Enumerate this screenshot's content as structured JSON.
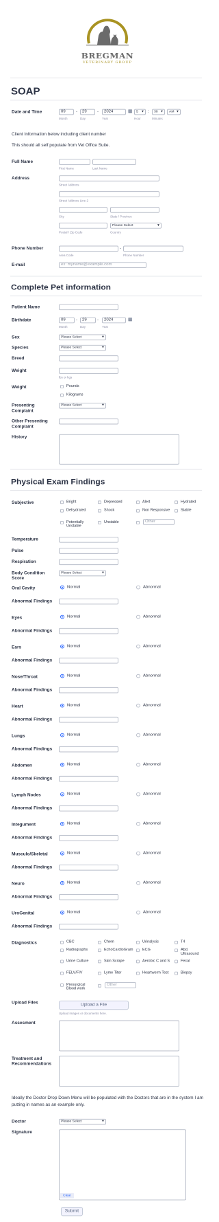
{
  "brand": {
    "name": "BREGMAN",
    "subtitle": "VETERINARY GROUP"
  },
  "form_title": "SOAP",
  "date_time": {
    "label": "Date and Time",
    "month": "09",
    "day": "29",
    "year": "2024",
    "hour": "5",
    "minute": "30",
    "ampm": "AM",
    "month_sub": "Month",
    "day_sub": "Day",
    "year_sub": "Year",
    "hour_sub": "Hour",
    "minute_sub": "Minutes"
  },
  "client_info_note": "Client Information below including client number",
  "autopopulate_note": "This should all self populate from Vet Office Suite.",
  "full_name": {
    "label": "Full Name",
    "first_sub": "First Name",
    "last_sub": "Last Name"
  },
  "address": {
    "label": "Address",
    "line1_sub": "Street Address",
    "line2_sub": "Street Address Line 2",
    "city_sub": "City",
    "state_sub": "State / Province",
    "postal_sub": "Postal / Zip Code",
    "country_sub": "Country",
    "country_value": "Please Select"
  },
  "phone": {
    "label": "Phone Number",
    "area_sub": "Area Code",
    "number_sub": "Phone Number"
  },
  "email": {
    "label": "E-mail",
    "placeholder": "ex: myname@example.com"
  },
  "pet_section_title": "Complete Pet information",
  "pet": {
    "name_label": "Patient Name",
    "birthdate_label": "Birthdate",
    "birth_month": "09",
    "birth_day": "29",
    "birth_year": "2024",
    "month_sub": "Month",
    "day_sub": "Day",
    "year_sub": "Year",
    "sex_label": "Sex",
    "sex_value": "Please Select",
    "species_label": "Species",
    "species_value": "Please Select",
    "breed_label": "Breed",
    "weight_label": "Weight",
    "weight_sub": "lbs or kgs",
    "weight_unit_label": "Weight",
    "unit_pounds": "Pounds",
    "unit_kilograms": "Kilograms",
    "complaint_label": "Presenting Complaint",
    "complaint_value": "Please Select",
    "other_complaint_label": "Other Presenting Complaint",
    "history_label": "History"
  },
  "exam_section_title": "Physical Exam Findings",
  "subjective": {
    "label": "Subjective",
    "options": [
      "Bright",
      "Depressed",
      "Alert",
      "Hydrated",
      "Dehydrated",
      "Shock",
      "Non Responsive",
      "Stable",
      "Potentially Unstable",
      "Unstable",
      "Other"
    ]
  },
  "vitals": {
    "temperature": "Temperature",
    "pulse": "Pulse",
    "respiration": "Respiration",
    "bcs_label": "Body Condition Score",
    "bcs_value": "Please Select"
  },
  "systems": [
    "Oral Cavity",
    "Eyes",
    "Ears",
    "Nose/Throat",
    "Heart",
    "Lungs",
    "Abdomen",
    "Lymph Nodes",
    "Integument",
    "Musculo/Skeletal",
    "Neuro",
    "UroGenital"
  ],
  "radio_normal": "Normal",
  "radio_abnormal": "Abnormal",
  "abnormal_findings_label": "Abnormal Findings",
  "diagnostics": {
    "label": "Diagnostics",
    "options": [
      "CBC",
      "Chem",
      "Urinalysis",
      "T4",
      "Radiographs",
      "EchoCardioGram",
      "ECG",
      "Abd. Ultrasound",
      "Urine Culture",
      "Skin Scrape",
      "Aerobic C and S",
      "Fecal",
      "FELV/FIV",
      "Lyme Titer",
      "Heartworm Test",
      "Biopsy",
      "Presurgical Blood work",
      "Other"
    ]
  },
  "upload": {
    "label": "Upload Files",
    "button": "Upload a File",
    "sub": "Upload images or documents here."
  },
  "assessment_label": "Assesment",
  "treatment_label": "Treatment and Recommendations",
  "doctor_note": "Ideally the Doctor Drop Down Menu will be populated with the Doctors that are in the system  I am putting in names as an example only.",
  "doctor": {
    "label": "Doctor",
    "value": "Please Select"
  },
  "signature": {
    "label": "Signature",
    "clear": "Clear"
  },
  "submit": "Submit",
  "colors": {
    "accent": "#2e69ff",
    "logo_gold": "#a99322",
    "text": "#2c3345"
  }
}
